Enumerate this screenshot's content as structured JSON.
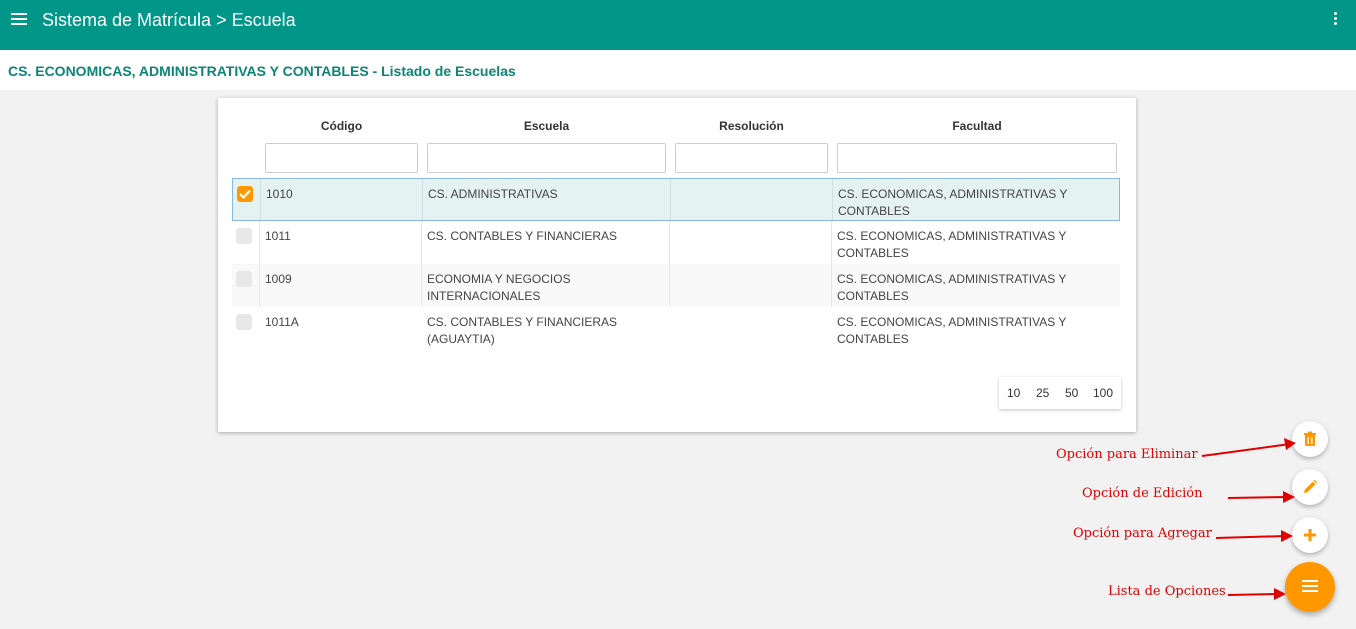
{
  "appbar": {
    "title": "Sistema de Matrícula > Escuela"
  },
  "subheader": {
    "title": "CS. ECONOMICAS, ADMINISTRATIVAS Y CONTABLES - Listado de Escuelas"
  },
  "table": {
    "headers": {
      "codigo": "Código",
      "escuela": "Escuela",
      "resolucion": "Resolución",
      "facultad": "Facultad"
    },
    "filters": {
      "codigo": "",
      "escuela": "",
      "resolucion": "",
      "facultad": ""
    },
    "rows": [
      {
        "selected": true,
        "codigo": "1010",
        "escuela": [
          "CS. ADMINISTRATIVAS",
          ""
        ],
        "resolucion": "",
        "facultad": [
          "CS. ECONOMICAS, ADMINISTRATIVAS Y",
          "CONTABLES"
        ]
      },
      {
        "selected": false,
        "codigo": "1011",
        "escuela": [
          "CS. CONTABLES Y FINANCIERAS",
          ""
        ],
        "resolucion": "",
        "facultad": [
          "CS. ECONOMICAS, ADMINISTRATIVAS Y",
          "CONTABLES"
        ]
      },
      {
        "selected": false,
        "codigo": "1009",
        "escuela": [
          "ECONOMIA Y NEGOCIOS",
          "INTERNACIONALES"
        ],
        "resolucion": "",
        "facultad": [
          "CS. ECONOMICAS, ADMINISTRATIVAS Y",
          "CONTABLES"
        ]
      },
      {
        "selected": false,
        "codigo": "1011A",
        "escuela": [
          "CS. CONTABLES Y FINANCIERAS",
          "(AGUAYTIA)"
        ],
        "resolucion": "",
        "facultad": [
          "CS. ECONOMICAS, ADMINISTRATIVAS Y",
          "CONTABLES"
        ]
      }
    ]
  },
  "pager": {
    "sizes": [
      "10",
      "25",
      "50",
      "100"
    ]
  },
  "actions": {
    "delete_icon": "trash-icon",
    "edit_icon": "pencil-icon",
    "add_icon": "plus-icon",
    "menu_icon": "list-icon",
    "accent": "#ff9800",
    "primary": "#009688"
  },
  "annotations": {
    "delete": "Opción para Eliminar",
    "edit": "Opción de Edición",
    "add": "Opción para Agregar",
    "options": "Lista de Opciones",
    "color": "#e00000"
  }
}
